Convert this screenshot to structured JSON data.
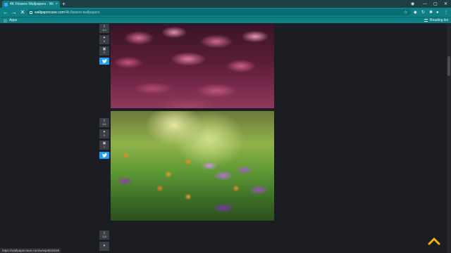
{
  "browser": {
    "tab_title": "4K Flowers Wallpapers - Wallpa...",
    "new_tab_label": "+",
    "url_host": "wallpapercave.com",
    "url_path": "/4k-flowers-wallpapers",
    "bookmarks": {
      "apps_label": "Apps",
      "reading_list_label": "Reading list"
    },
    "status_url": "https://wallpapercave.com/w/wp4515639"
  },
  "wallpapers": [
    {
      "download_count": "114",
      "like_count": "8",
      "comment_count": "0"
    },
    {
      "download_count": "111",
      "like_count": "0",
      "comment_count": "1"
    },
    {
      "download_count": "118"
    }
  ],
  "colors": {
    "chrome_accent": "#0e7f86",
    "page_background": "#1b1d22",
    "twitter_blue": "#1da1f2",
    "scroll_top_arrow": "#f2b705"
  }
}
